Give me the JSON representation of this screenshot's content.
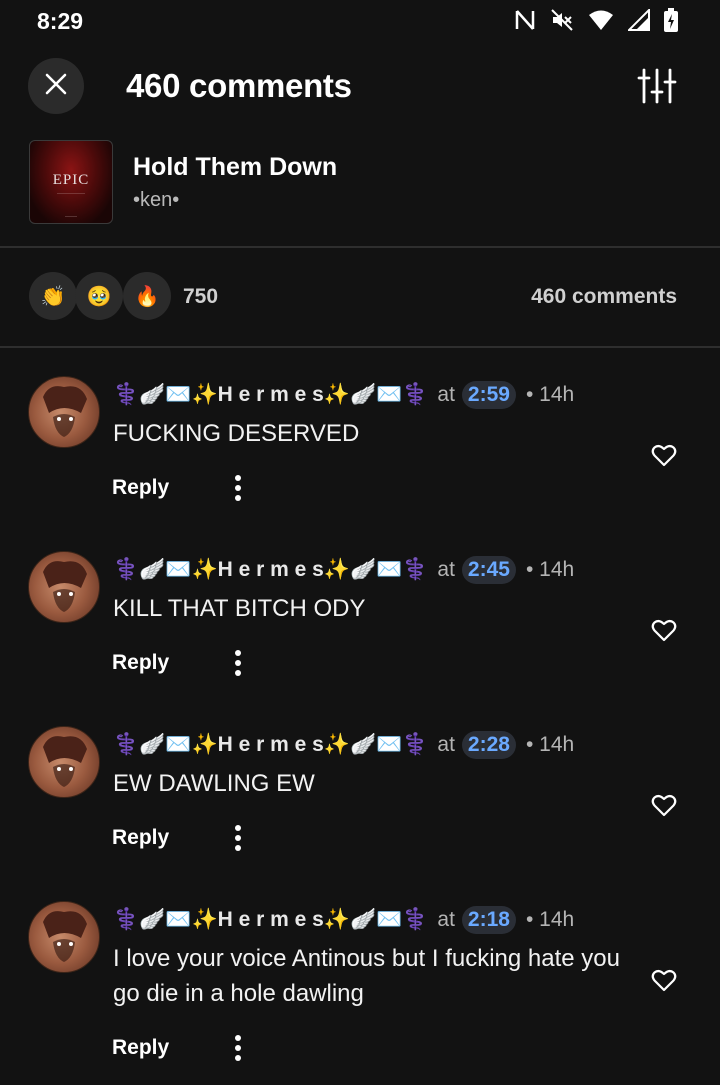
{
  "status_bar": {
    "time": "8:29"
  },
  "header": {
    "title": "460 comments"
  },
  "track": {
    "title": "Hold Them Down",
    "artist": "•ken•",
    "art_title": "EPIC"
  },
  "reactions": {
    "emojis": [
      "👏",
      "🥹",
      "🔥"
    ],
    "count": "750",
    "comments_count": "460 comments"
  },
  "comments": [
    {
      "author": "⚕️🪽✉️✨H e r m e s✨🪽✉️⚕️",
      "at": "at",
      "timestamp": "2:59",
      "ago": "• 14h",
      "text": "FUCKING DESERVED",
      "reply": "Reply"
    },
    {
      "author": "⚕️🪽✉️✨H e r m e s✨🪽✉️⚕️",
      "at": "at",
      "timestamp": "2:45",
      "ago": "• 14h",
      "text": "KILL THAT BITCH ODY",
      "reply": "Reply"
    },
    {
      "author": "⚕️🪽✉️✨H e r m e s✨🪽✉️⚕️",
      "at": "at",
      "timestamp": "2:28",
      "ago": "• 14h",
      "text": "EW DAWLING EW",
      "reply": "Reply"
    },
    {
      "author": "⚕️🪽✉️✨H e r m e s✨🪽✉️⚕️",
      "at": "at",
      "timestamp": "2:18",
      "ago": "• 14h",
      "text": "I love your voice Antinous but I fucking hate you go die in a hole dawling",
      "reply": "Reply"
    }
  ]
}
